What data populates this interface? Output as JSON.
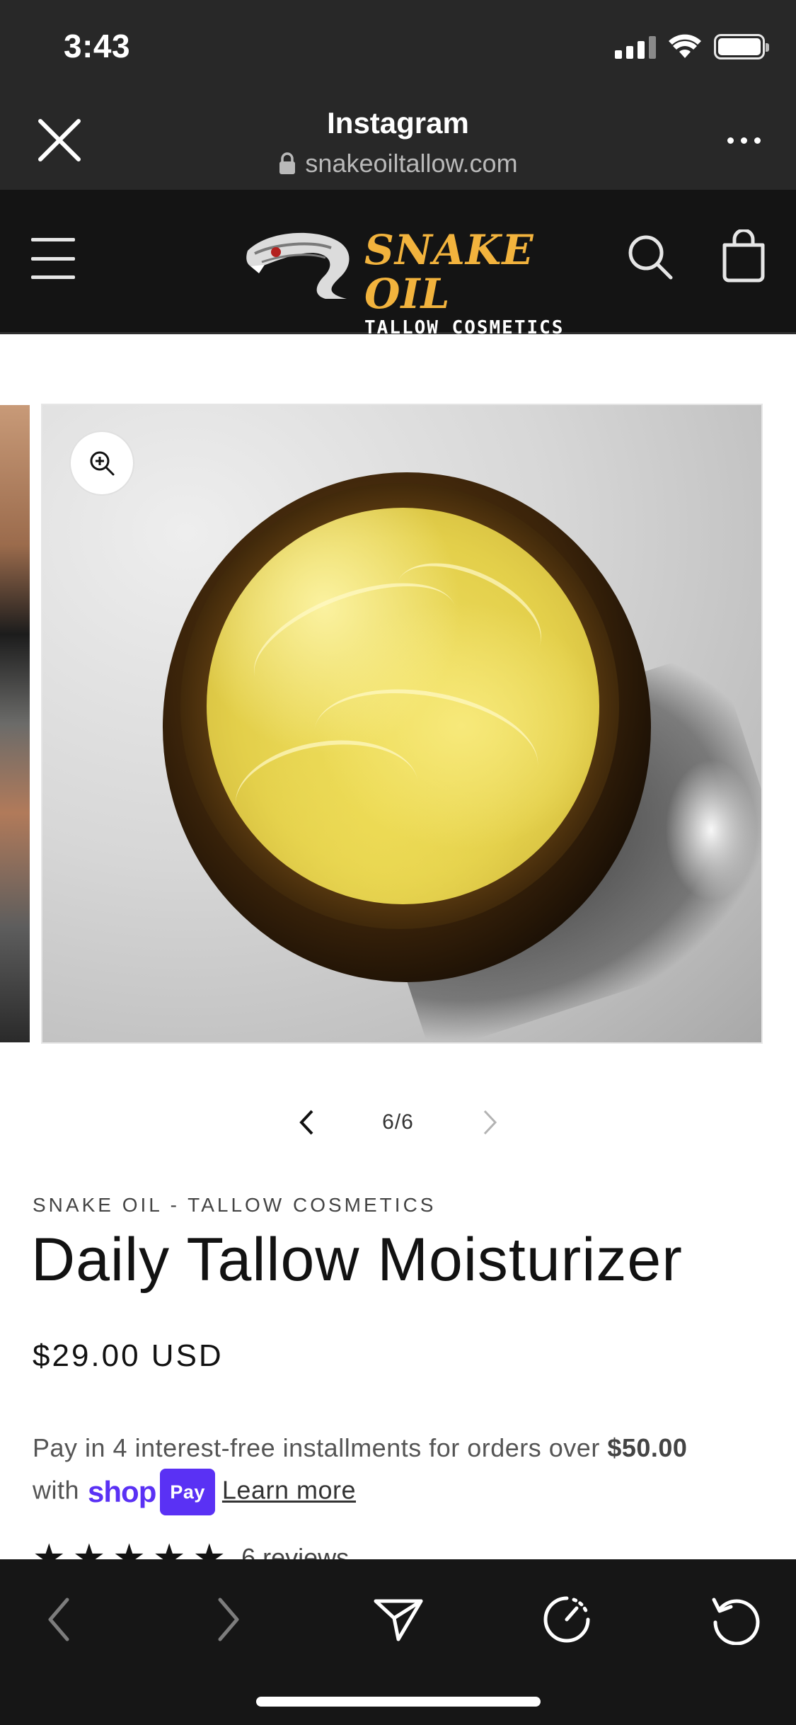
{
  "status_bar": {
    "time": "3:43"
  },
  "browser": {
    "title": "Instagram",
    "url": "snakeoiltallow.com"
  },
  "store": {
    "logo_big": "SNAKE OIL",
    "logo_small": "TALLOW COSMETICS"
  },
  "slider": {
    "counter": "6/6",
    "current": 6,
    "total": 6
  },
  "product": {
    "vendor": "SNAKE OIL - TALLOW COSMETICS",
    "title": "Daily Tallow Moisturizer",
    "price": "$29.00 USD",
    "installments_prefix": "Pay in 4 interest-free installments for orders over ",
    "installments_amount": "$50.00",
    "installments_with": "with",
    "shop_word": "shop",
    "pay_badge": "Pay",
    "learn_more": "Learn more",
    "rating_stars": 5,
    "reviews": "6 reviews"
  },
  "icons": {
    "close": "close-icon",
    "more": "more-icon",
    "menu": "hamburger-menu-icon",
    "search": "search-icon",
    "cart": "cart-icon",
    "zoom": "zoom-in-icon",
    "back": "chevron-left-icon",
    "forward": "chevron-right-icon",
    "share": "send-icon",
    "speed": "gauge-icon",
    "reload": "reload-icon"
  },
  "colors": {
    "chrome_bg": "#282828",
    "store_header_bg": "#141414",
    "logo_gold": "#f2b33d",
    "shop_pay_purple": "#5a31f4"
  }
}
